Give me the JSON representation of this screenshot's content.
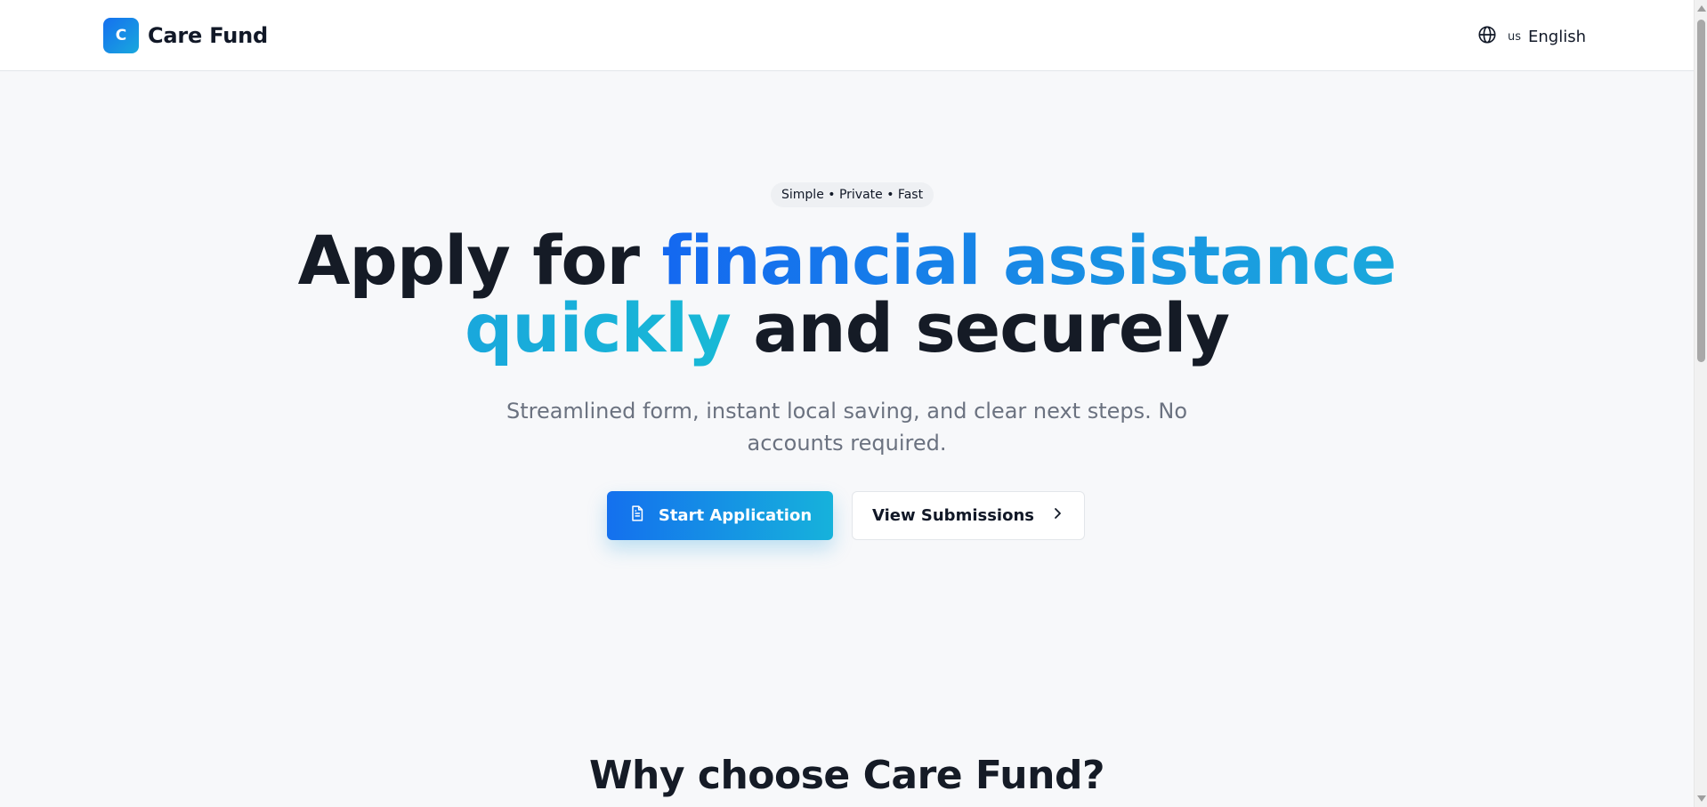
{
  "header": {
    "logo_letter": "C",
    "brand_name": "Care Fund",
    "language": {
      "code": "us",
      "label": "English",
      "icon": "globe-icon"
    }
  },
  "hero": {
    "badge": "Simple • Private • Fast",
    "headline": {
      "prefix": "Apply for ",
      "highlight": "financial assistance quickly",
      "suffix": " and securely"
    },
    "subtitle": "Streamlined form, instant local saving, and clear next steps. No accounts required.",
    "primary_button": {
      "label": "Start Application",
      "icon": "document-icon"
    },
    "secondary_button": {
      "label": "View Submissions",
      "icon": "chevron-right-icon"
    }
  },
  "features": {
    "title": "Why choose Care Fund?"
  },
  "colors": {
    "accent_start": "#1468f0",
    "accent_end": "#18b9d6",
    "text_dark": "#151b26",
    "text_muted": "#6b7280",
    "background": "#f7f8fa"
  }
}
